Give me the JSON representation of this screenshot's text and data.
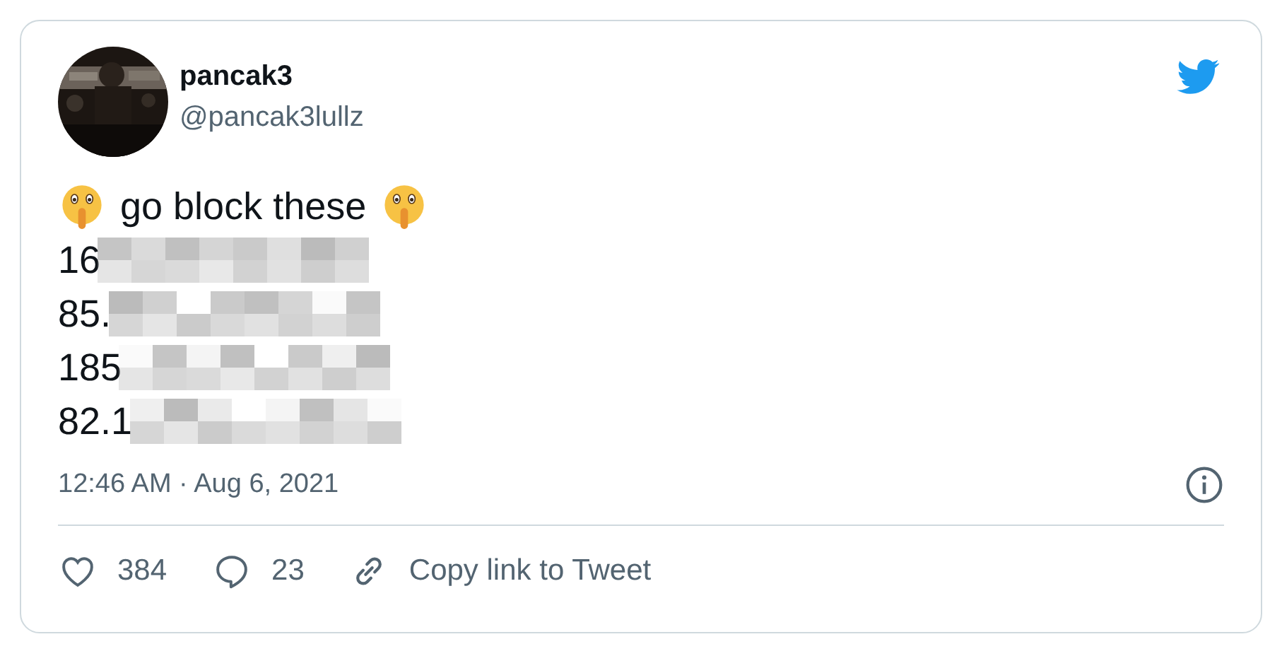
{
  "author": {
    "name": "pancak3",
    "handle": "@pancak3lullz"
  },
  "tweet": {
    "text": "go block these",
    "lines": [
      {
        "text": "16",
        "redacted": true
      },
      {
        "text": "85.",
        "redacted": true
      },
      {
        "text": "185",
        "redacted": true
      },
      {
        "text": "82.1",
        "redacted": true
      }
    ]
  },
  "timestamp": "12:46 AM · Aug 6, 2021",
  "actions": [
    {
      "kind": "like",
      "label": "384"
    },
    {
      "kind": "reply",
      "label": "23"
    },
    {
      "kind": "copy",
      "label": "Copy link to Tweet"
    }
  ]
}
